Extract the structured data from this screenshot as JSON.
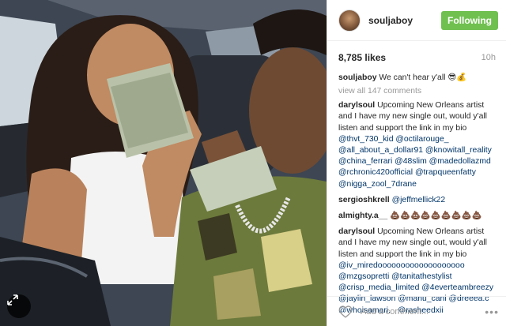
{
  "header": {
    "username": "souljaboy",
    "follow_label": "Following"
  },
  "stats": {
    "likes": "8,785 likes",
    "time": "10h"
  },
  "caption": {
    "author": "souljaboy",
    "text": "We can't hear y'all 😎💰"
  },
  "view_all": "view all 147 comments",
  "comments": [
    {
      "author": "darylsoul",
      "text": "Upcoming New Orleans artist and I have my new single out, would y'all listen and support the link in my bio",
      "tags": "@thvt_730_kid @octilarouge_ @all_about_a_dollar91 @knowitall_reality @china_ferrari @48slim @madedollazmd @rchronic420official @trapqueenfatty @nigga_zool_7drane"
    },
    {
      "author": "sergioshkrell",
      "text": "",
      "tags": "@jeffmellick22"
    },
    {
      "author": "almighty.a__",
      "text": "💩💩💩💩💩💩💩💩💩",
      "tags": ""
    },
    {
      "author": "darylsoul",
      "text": "Upcoming New Orleans artist and I have my new single out, would y'all listen and support the link in my bio",
      "tags": "@iv_miredooooooooooooooooooo @mzgsopretti @tanitathestylist @crisp_media_limited @4everteambreezy @jaylin_lawson @manu_cani @dreeea.c @whoisamari._ @rasheedxii"
    }
  ],
  "footer": {
    "placeholder": "Add a comment...",
    "more": "•••"
  },
  "icons": {
    "expand": "expand-icon",
    "heart": "heart-icon"
  },
  "colors": {
    "follow_bg": "#70c050",
    "tag": "#003569",
    "muted": "#999999"
  }
}
